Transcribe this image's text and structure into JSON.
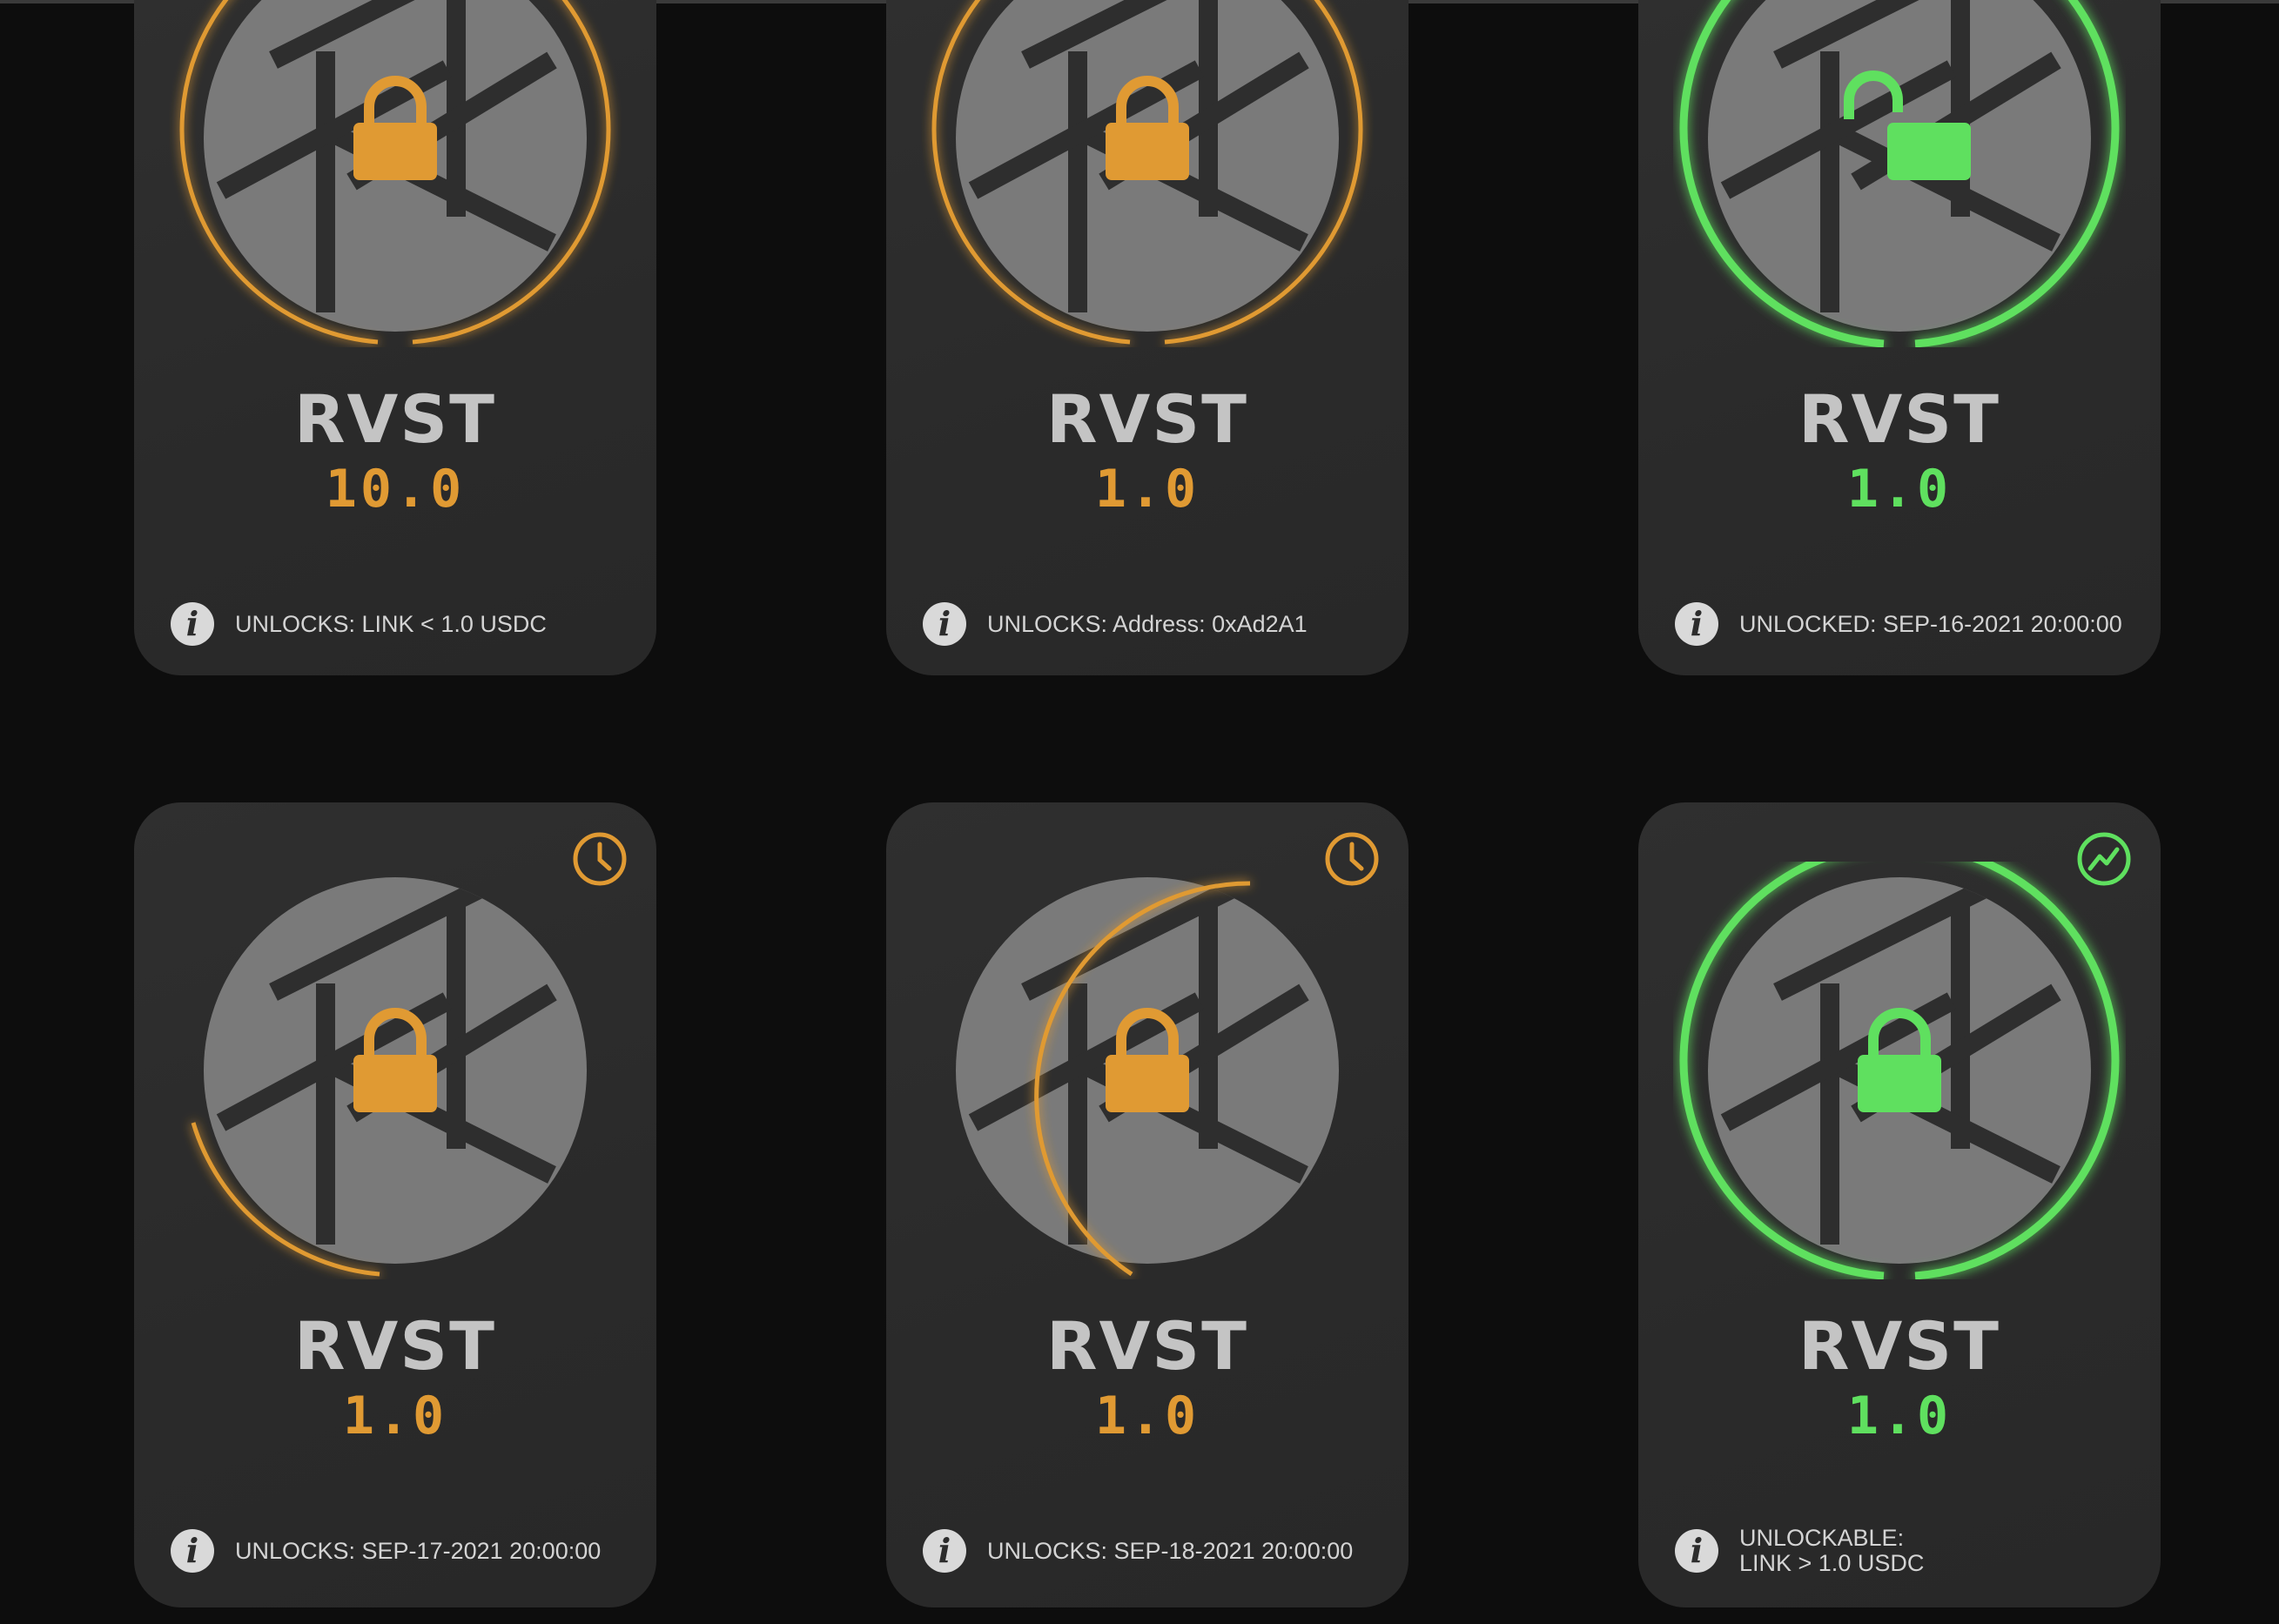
{
  "colors": {
    "locked_accent": "#e09a33",
    "unlocked_accent": "#5fe05f",
    "card_bg": "#2d2d2d",
    "page_bg": "#0d0d0d",
    "aperture_gray": "#7a7a7a"
  },
  "cards": [
    {
      "ticker": "RVST",
      "amount": "10.0",
      "state": "locked",
      "lock_icon": "lock-closed-icon",
      "info": [
        "UNLOCKS: LINK < 1.0 USDC"
      ]
    },
    {
      "ticker": "RVST",
      "amount": "1.0",
      "state": "locked",
      "lock_icon": "lock-closed-icon",
      "info": [
        "UNLOCKS: Address: 0xAd2A1"
      ]
    },
    {
      "ticker": "RVST",
      "amount": "1.0",
      "state": "unlocked",
      "lock_icon": "lock-open-icon",
      "info": [
        "UNLOCKED: SEP-16-2021 20:00:00"
      ]
    },
    {
      "ticker": "RVST",
      "amount": "1.0",
      "state": "locked",
      "lock_icon": "lock-closed-icon",
      "badge_icon": "clock-icon",
      "info": [
        "UNLOCKS: SEP-17-2021 20:00:00"
      ]
    },
    {
      "ticker": "RVST",
      "amount": "1.0",
      "state": "locked",
      "lock_icon": "lock-closed-icon",
      "badge_icon": "clock-icon",
      "info": [
        "UNLOCKS: SEP-18-2021 20:00:00"
      ]
    },
    {
      "ticker": "RVST",
      "amount": "1.0",
      "state": "unlockable",
      "lock_icon": "lock-closed-icon",
      "badge_icon": "trend-up-icon",
      "info": [
        "UNLOCKABLE:",
        "LINK > 1.0 USDC"
      ]
    }
  ]
}
